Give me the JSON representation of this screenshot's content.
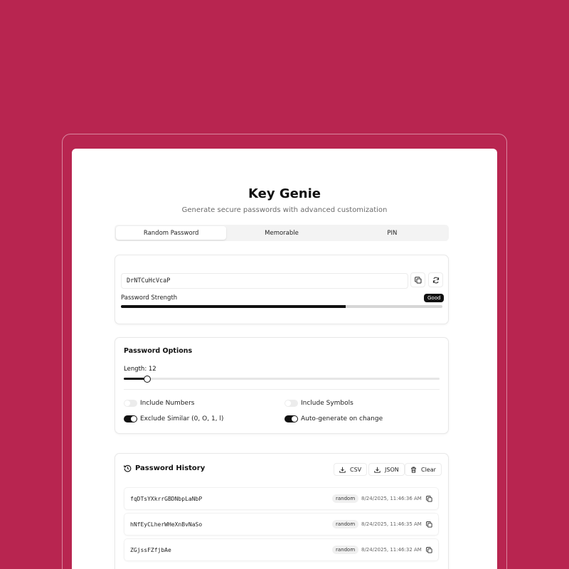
{
  "header": {
    "title": "Key Genie",
    "subtitle": "Generate secure passwords with advanced customization"
  },
  "tabs": [
    {
      "label": "Random Password",
      "active": true
    },
    {
      "label": "Memorable",
      "active": false
    },
    {
      "label": "PIN",
      "active": false
    }
  ],
  "generator": {
    "password": "DrNTCuHcVcaP",
    "strength_label": "Password Strength",
    "strength_value": "Good",
    "strength_fraction": 0.7
  },
  "options": {
    "title": "Password Options",
    "length_label": "Length: 12",
    "length_fraction": 0.075,
    "toggles": [
      {
        "label": "Include Numbers",
        "on": false
      },
      {
        "label": "Include Symbols",
        "on": false
      },
      {
        "label": "Exclude Similar (0, O, 1, l)",
        "on": true
      },
      {
        "label": "Auto-generate on change",
        "on": true
      }
    ]
  },
  "history": {
    "title": "Password History",
    "csv_label": "CSV",
    "json_label": "JSON",
    "clear_label": "Clear",
    "items": [
      {
        "password": "fqDTsYXkrrGBDNbpLaNbP",
        "type": "random",
        "time": "8/24/2025, 11:46:36 AM"
      },
      {
        "password": "hNfEyCLherWHeXnBvNaSo",
        "type": "random",
        "time": "8/24/2025, 11:46:35 AM"
      },
      {
        "password": "ZGjssFZfjbAe",
        "type": "random",
        "time": "8/24/2025, 11:46:32 AM"
      }
    ]
  },
  "colors": {
    "background": "#b82550",
    "accent": "#111111"
  }
}
